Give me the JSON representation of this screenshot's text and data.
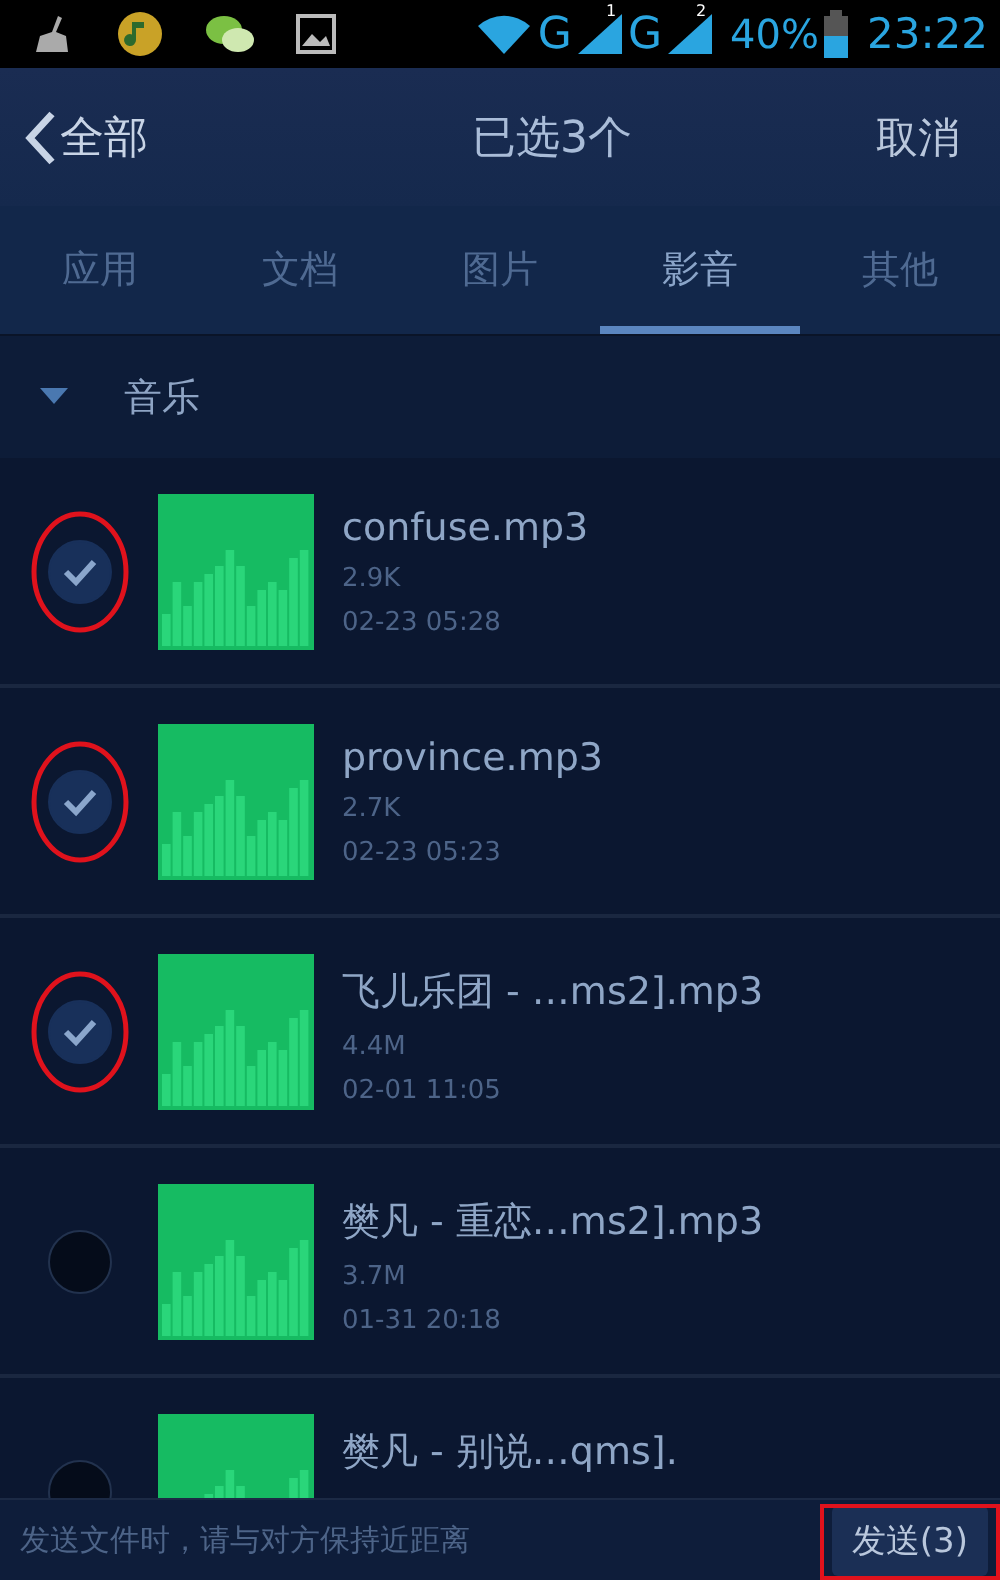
{
  "status_bar": {
    "sim1_label": "G",
    "sim1_index": "1",
    "sim2_label": "G",
    "sim2_index": "2",
    "battery": "40%",
    "time": "23:22"
  },
  "header": {
    "back": "全部",
    "title": "已选3个",
    "cancel": "取消"
  },
  "tabs": [
    {
      "label": "应用",
      "selected": false
    },
    {
      "label": "文档",
      "selected": false
    },
    {
      "label": "图片",
      "selected": false
    },
    {
      "label": "影音",
      "selected": true
    },
    {
      "label": "其他",
      "selected": false
    }
  ],
  "section": {
    "title": "音乐",
    "expanded": true
  },
  "files": [
    {
      "name": "confuse.mp3",
      "size": "2.9K",
      "date": "02-23 05:28",
      "checked": true,
      "annotated": true
    },
    {
      "name": "province.mp3",
      "size": "2.7K",
      "date": "02-23 05:23",
      "checked": true,
      "annotated": true
    },
    {
      "name": "飞儿乐团 - …ms2].mp3",
      "size": "4.4M",
      "date": "02-01 11:05",
      "checked": true,
      "annotated": true
    },
    {
      "name": "樊凡 - 重恋…ms2].mp3",
      "size": "3.7M",
      "date": "01-31 20:18",
      "checked": false,
      "annotated": false
    },
    {
      "name": "樊凡 - 别说…qms].",
      "checked": false,
      "annotated": false
    }
  ],
  "bottom_bar": {
    "hint": "发送文件时，请与对方保持近距离",
    "send": "发送(3)",
    "send_annotated": true
  }
}
